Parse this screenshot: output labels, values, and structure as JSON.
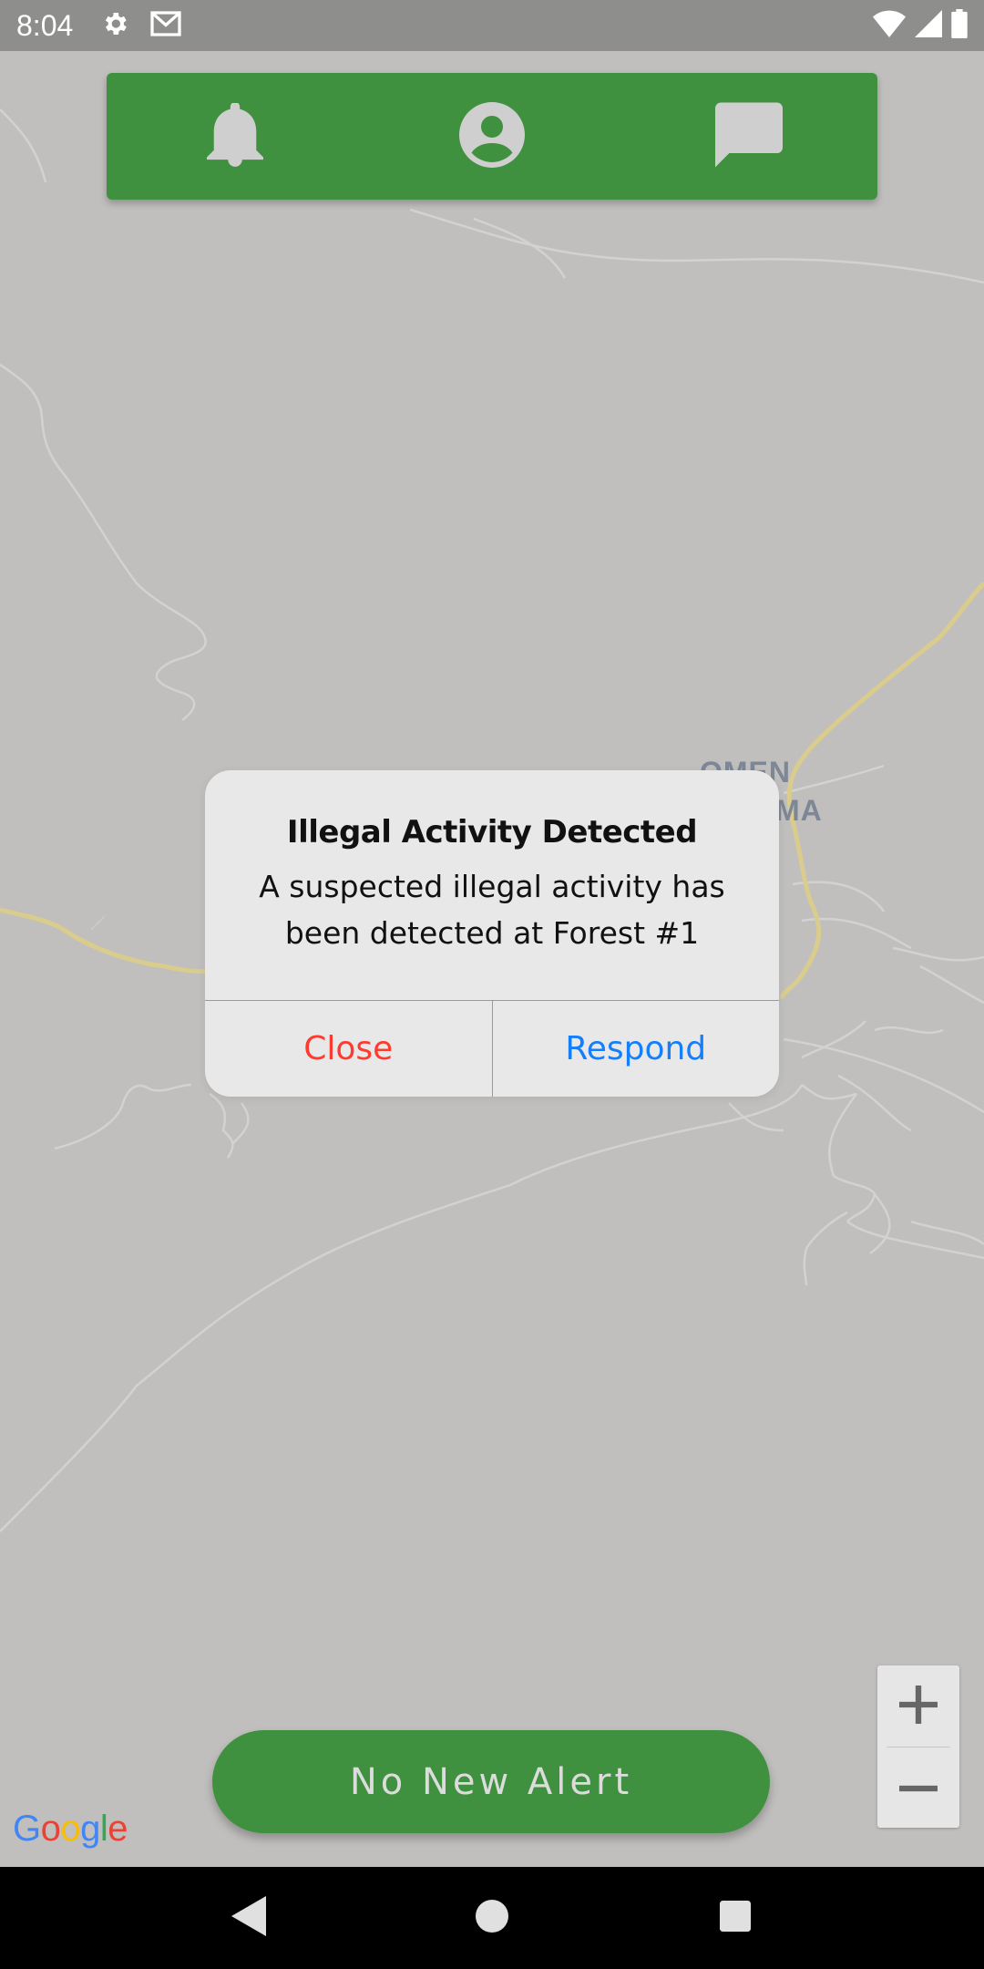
{
  "status_bar": {
    "time": "8:04",
    "left_icons": [
      "gear-icon",
      "gmail-icon"
    ],
    "right_icons": [
      "wifi-icon",
      "cell-signal-icon",
      "battery-icon"
    ]
  },
  "top_nav": {
    "background": "#3f913f",
    "icon_color": "#cfcfcf",
    "items": [
      {
        "name": "notifications",
        "icon": "bell-icon"
      },
      {
        "name": "profile",
        "icon": "account-circle-icon"
      },
      {
        "name": "messages",
        "icon": "chat-icon"
      }
    ]
  },
  "map": {
    "place_label_lines": [
      "OMEN",
      "MA"
    ],
    "attribution": "Google",
    "zoom": {
      "in": "+",
      "out": "−"
    }
  },
  "dialog": {
    "title": "Illegal Activity Detected",
    "message_line1": "A suspected illegal activity has",
    "message_line2": "been detected at Forest #1",
    "close_label": "Close",
    "respond_label": "Respond",
    "close_color": "#ff3b30",
    "respond_color": "#147efb"
  },
  "alert_button": {
    "label": "No New Alert",
    "background": "#3f913f"
  },
  "android_nav": [
    "back-icon",
    "home-icon",
    "recents-icon"
  ]
}
